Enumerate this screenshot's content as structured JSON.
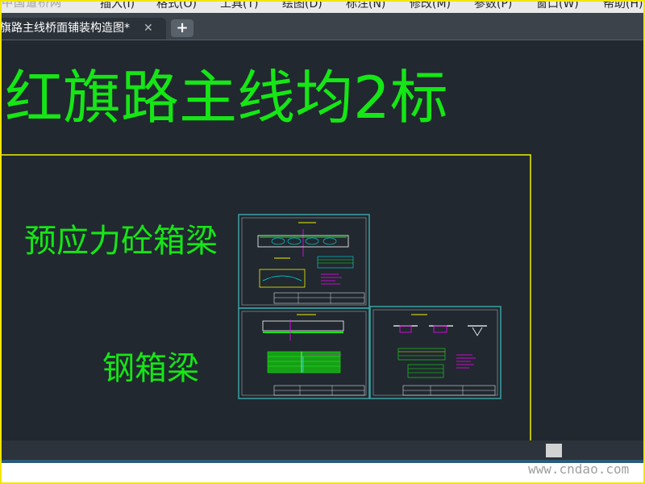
{
  "menu": {
    "items": [
      {
        "label": "插入(I)"
      },
      {
        "label": "格式(O)"
      },
      {
        "label": "工具(T)"
      },
      {
        "label": "绘图(D)"
      },
      {
        "label": "标注(N)"
      },
      {
        "label": "修改(M)"
      },
      {
        "label": "参数(P)"
      },
      {
        "label": "窗口(W)"
      },
      {
        "label": "帮助(H)"
      }
    ],
    "watermark_logo": "中国道桥网"
  },
  "tabs": {
    "active_label": "旗路主线桥面铺装构造图*",
    "close_glyph": "✕",
    "add_glyph": "+"
  },
  "drawing": {
    "main_title": "红旗路主线均2标",
    "label_prestressed": "预应力砼箱梁",
    "label_steel": "钢箱梁",
    "colors": {
      "background": "#212830",
      "text_green": "#15e615",
      "frame_yellow": "#f0f000",
      "sheet_border": "#3aa0a0",
      "magenta": "#ff00ff"
    }
  },
  "scrollbar": {
    "type": "horizontal"
  },
  "watermark": "www.cndao.com"
}
